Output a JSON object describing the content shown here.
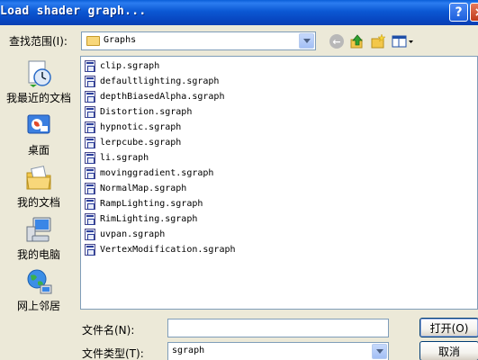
{
  "window": {
    "title": "Load shader graph..."
  },
  "toolbar": {
    "lookin_label": "查找范围(I):",
    "lookin_value": "Graphs"
  },
  "places": [
    {
      "label": "我最近的文档",
      "icon": "recent-documents-icon"
    },
    {
      "label": "桌面",
      "icon": "desktop-icon"
    },
    {
      "label": "我的文档",
      "icon": "my-documents-icon"
    },
    {
      "label": "我的电脑",
      "icon": "my-computer-icon"
    },
    {
      "label": "网上邻居",
      "icon": "network-places-icon"
    }
  ],
  "files": [
    "clip.sgraph",
    "defaultlighting.sgraph",
    "depthBiasedAlpha.sgraph",
    "Distortion.sgraph",
    "hypnotic.sgraph",
    "lerpcube.sgraph",
    "li.sgraph",
    "movinggradient.sgraph",
    "NormalMap.sgraph",
    "RampLighting.sgraph",
    "RimLighting.sgraph",
    "uvpan.sgraph",
    "VertexModification.sgraph"
  ],
  "bottom": {
    "filename_label": "文件名(N):",
    "filename_value": "",
    "filetype_label": "文件类型(T):",
    "filetype_value": "sgraph",
    "open_label": "打开(O)",
    "cancel_label": "取消"
  }
}
